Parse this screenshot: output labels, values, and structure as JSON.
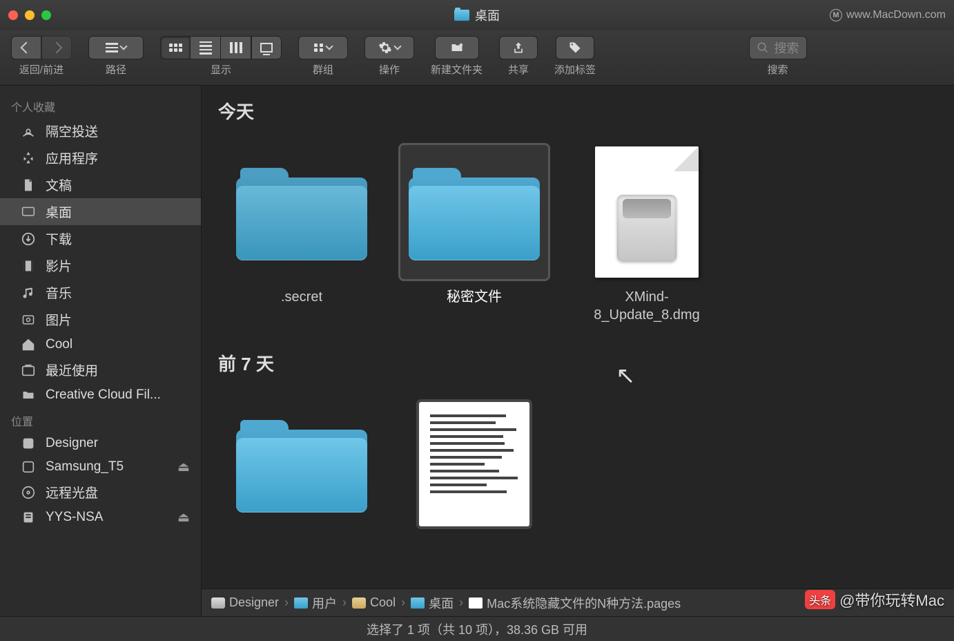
{
  "window": {
    "title": "桌面",
    "watermark_url": "www.MacDown.com"
  },
  "toolbar": {
    "back_forward": "返回/前进",
    "path": "路径",
    "view": "显示",
    "group": "群组",
    "action": "操作",
    "new_folder": "新建文件夹",
    "share": "共享",
    "tags": "添加标签",
    "search_label": "搜索",
    "search_placeholder": "搜索"
  },
  "sidebar": {
    "favorites_heading": "个人收藏",
    "favorites": [
      {
        "label": "隔空投送",
        "icon": "airdrop"
      },
      {
        "label": "应用程序",
        "icon": "apps"
      },
      {
        "label": "文稿",
        "icon": "documents"
      },
      {
        "label": "桌面",
        "icon": "desktop",
        "selected": true
      },
      {
        "label": "下载",
        "icon": "downloads"
      },
      {
        "label": "影片",
        "icon": "movies"
      },
      {
        "label": "音乐",
        "icon": "music"
      },
      {
        "label": "图片",
        "icon": "pictures"
      },
      {
        "label": "Cool",
        "icon": "home"
      },
      {
        "label": "最近使用",
        "icon": "recents"
      },
      {
        "label": "Creative Cloud Fil...",
        "icon": "folder"
      }
    ],
    "locations_heading": "位置",
    "locations": [
      {
        "label": "Designer",
        "icon": "hd"
      },
      {
        "label": "Samsung_T5",
        "icon": "ext",
        "eject": true
      },
      {
        "label": "远程光盘",
        "icon": "disc"
      },
      {
        "label": "YYS-NSA",
        "icon": "nas",
        "eject": true
      }
    ]
  },
  "content": {
    "sections": [
      {
        "title": "今天",
        "items": [
          {
            "name": ".secret",
            "type": "folder",
            "hidden": true
          },
          {
            "name": "秘密文件",
            "type": "folder",
            "selected": true
          },
          {
            "name": "XMind-8_Update_8.dmg",
            "type": "dmg"
          }
        ]
      },
      {
        "title": "前 7 天",
        "items": [
          {
            "name": "",
            "type": "folder"
          },
          {
            "name": "",
            "type": "pages"
          }
        ]
      }
    ]
  },
  "pathbar": [
    {
      "label": "Designer",
      "icon": "hd"
    },
    {
      "label": "用户",
      "icon": "folder"
    },
    {
      "label": "Cool",
      "icon": "home"
    },
    {
      "label": "桌面",
      "icon": "folder"
    },
    {
      "label": "Mac系统隐藏文件的N种方法.pages",
      "icon": "doc"
    }
  ],
  "status": "选择了 1 项（共 10 项），38.36 GB 可用",
  "watermark": {
    "badge": "头条",
    "text": "@带你玩转Mac"
  }
}
